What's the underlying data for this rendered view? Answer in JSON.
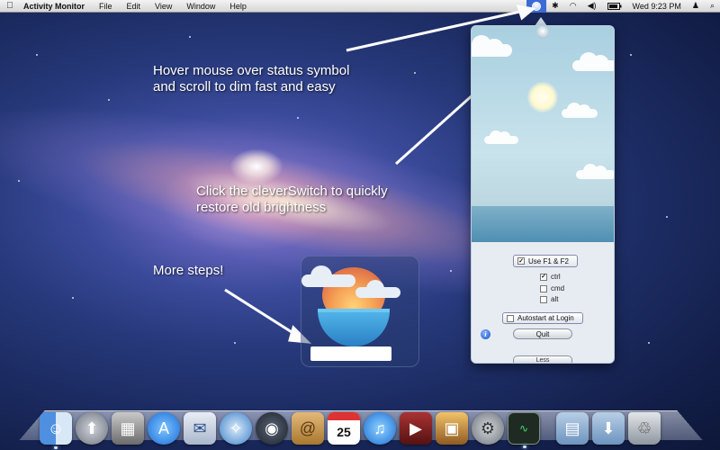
{
  "menubar": {
    "app_name": "Activity Monitor",
    "menus": [
      "File",
      "Edit",
      "View",
      "Window",
      "Help"
    ],
    "clock": "Wed 9:23 PM",
    "status_icons": [
      "bluetooth-icon",
      "wifi-icon",
      "volume-icon",
      "battery-icon",
      "user-icon",
      "spotlight-icon"
    ]
  },
  "annotations": {
    "hover_line1": "Hover mouse over status symbol",
    "hover_line2": "and scroll to dim fast and easy",
    "click_line1": "Click the cleverSwitch to quickly",
    "click_line2": "restore old brightness",
    "more": "More steps!"
  },
  "panel": {
    "use_f_label": "Use F1 & F2",
    "modifier_ctrl": "ctrl",
    "modifier_cmd": "cmd",
    "modifier_alt": "alt",
    "autostart_label": "Autostart at Login",
    "quit_label": "Quit",
    "less_label": "Less",
    "info_label": "i",
    "use_f_checked": true,
    "ctrl_checked": true,
    "cmd_checked": false,
    "alt_checked": false,
    "autostart_checked": false
  },
  "dock": {
    "ical_day": "25",
    "apps": [
      "Finder",
      "Launchpad",
      "Dashboard",
      "App Store",
      "Mail",
      "Safari",
      "FaceTime",
      "Address Book",
      "iCal",
      "iTunes",
      "Front Row",
      "iPhoto",
      "System Preferences",
      "Activity Monitor",
      "Applications",
      "Downloads",
      "Trash"
    ]
  }
}
